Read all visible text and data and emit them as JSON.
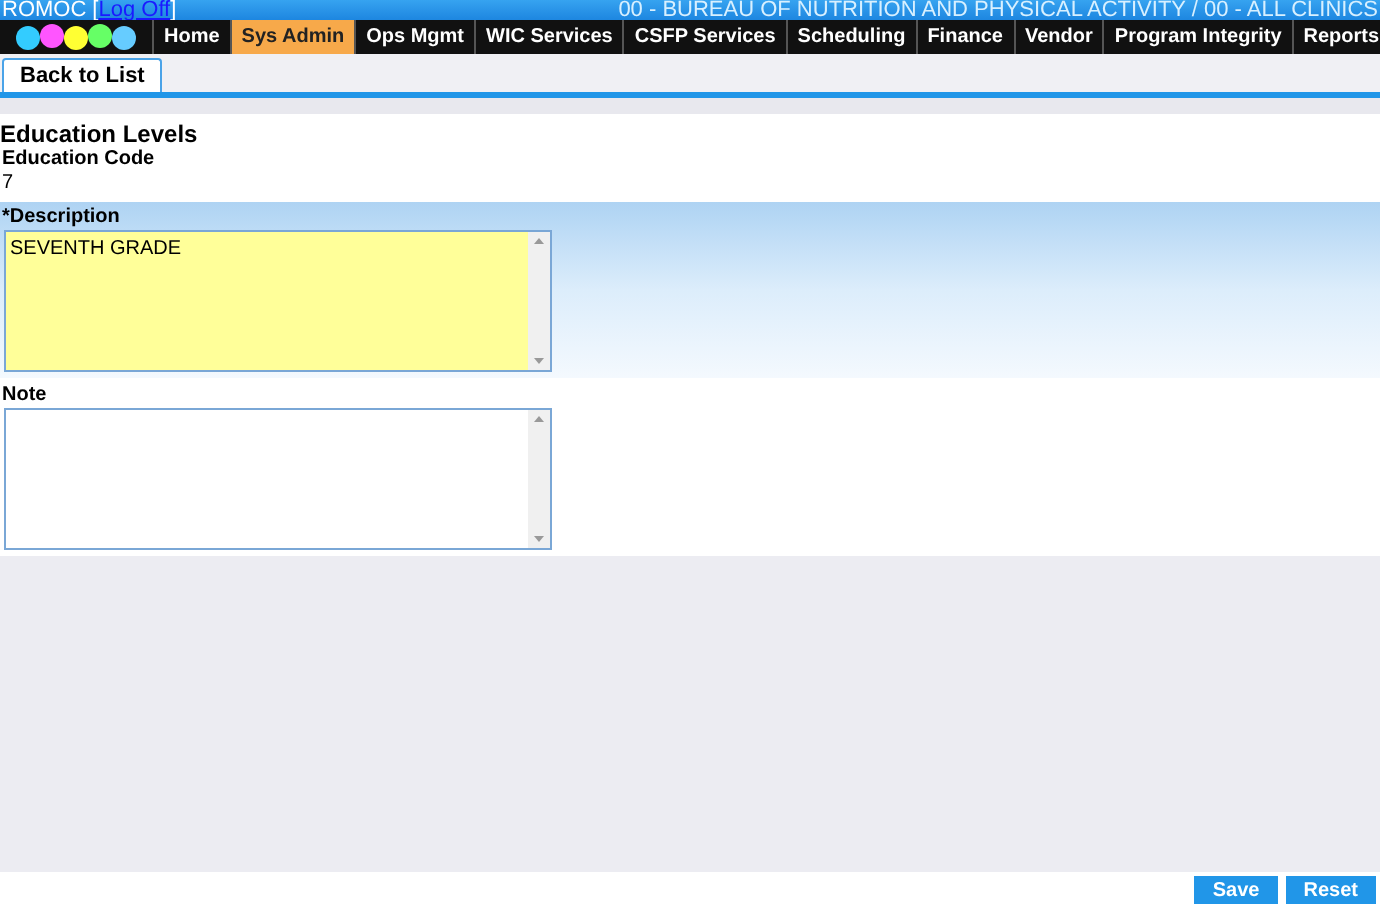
{
  "header": {
    "user": "ROMOC",
    "open_bracket": "[",
    "logoff": "Log Off",
    "close_bracket": "]",
    "context": "00 - BUREAU OF NUTRITION AND PHYSICAL ACTIVITY / 00 - ALL CLINICS"
  },
  "nav": [
    {
      "label": "Home",
      "selected": false
    },
    {
      "label": "Sys Admin",
      "selected": true
    },
    {
      "label": "Ops Mgmt",
      "selected": false
    },
    {
      "label": "WIC Services",
      "selected": false
    },
    {
      "label": "CSFP Services",
      "selected": false
    },
    {
      "label": "Scheduling",
      "selected": false
    },
    {
      "label": "Finance",
      "selected": false
    },
    {
      "label": "Vendor",
      "selected": false
    },
    {
      "label": "Program Integrity",
      "selected": false
    },
    {
      "label": "Reports",
      "selected": false
    }
  ],
  "back_button": "Back to List",
  "page_title": "Education Levels",
  "code": {
    "label": "Education Code",
    "value": "7"
  },
  "description": {
    "label": "*Description",
    "value": "SEVENTH GRADE"
  },
  "note": {
    "label": "Note"
  },
  "buttons": [
    "Save",
    "Reset"
  ]
}
